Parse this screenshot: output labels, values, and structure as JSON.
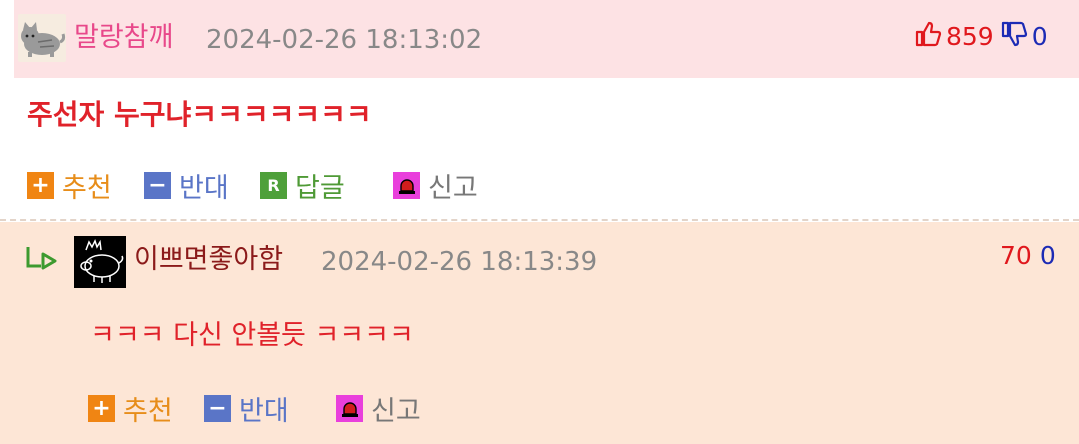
{
  "comment": {
    "nickname": "말랑참깨",
    "timestamp": "2024-02-26 18:13:02",
    "upvotes": "859",
    "downvotes": "0",
    "content": "주선자 누구냐ㅋㅋㅋㅋㅋㅋㅋ",
    "actions": {
      "recommend": "추천",
      "oppose": "반대",
      "reply": "답글",
      "report": "신고"
    },
    "reply_badge": "R"
  },
  "reply": {
    "nickname": "이쁘면좋아함",
    "timestamp": "2024-02-26 18:13:39",
    "upvotes": "70",
    "downvotes": "0",
    "content": "ㅋㅋㅋ 다신 안볼듯 ㅋㅋㅋㅋ",
    "actions": {
      "recommend": "추천",
      "oppose": "반대",
      "report": "신고"
    }
  },
  "colors": {
    "header_bg": "#fde2e4",
    "reply_bg": "#fde6d6",
    "nickname_pink": "#e8488a",
    "content_red": "#e0222a",
    "upvote_red": "#e0181d",
    "downvote_blue": "#1c2bb5"
  },
  "icons": [
    "cat-avatar-icon",
    "thumbs-up-icon",
    "thumbs-down-icon",
    "plus-icon",
    "minus-icon",
    "reply-icon",
    "siren-icon",
    "reply-arrow-icon",
    "pig-avatar-icon"
  ]
}
